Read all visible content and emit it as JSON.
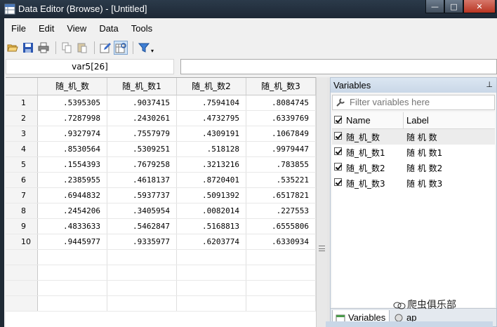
{
  "window": {
    "title": "Data Editor (Browse) - [Untitled]",
    "minimize_glyph": "—",
    "maximize_glyph": "□",
    "close_glyph": "✕"
  },
  "menu": [
    "File",
    "Edit",
    "View",
    "Data",
    "Tools"
  ],
  "toolbar": {
    "icons": [
      "open-icon",
      "save-icon",
      "print-icon",
      "copy-icon",
      "paste-icon",
      "edit-icon",
      "browse-icon",
      "filter-icon"
    ]
  },
  "cell_reference": "var5[26]",
  "grid": {
    "columns": [
      "随_机_数",
      "随_机_数1",
      "随_机_数2",
      "随_机_数3"
    ],
    "rows": [
      {
        "n": "1",
        "v": [
          ".5395305",
          ".9037415",
          ".7594104",
          ".8084745"
        ]
      },
      {
        "n": "2",
        "v": [
          ".7287998",
          ".2430261",
          ".4732795",
          ".6339769"
        ]
      },
      {
        "n": "3",
        "v": [
          ".9327974",
          ".7557979",
          ".4309191",
          ".1067849"
        ]
      },
      {
        "n": "4",
        "v": [
          ".8530564",
          ".5309251",
          ".518128",
          ".9979447"
        ]
      },
      {
        "n": "5",
        "v": [
          ".1554393",
          ".7679258",
          ".3213216",
          ".783855"
        ]
      },
      {
        "n": "6",
        "v": [
          ".2385955",
          ".4618137",
          ".8720401",
          ".535221"
        ]
      },
      {
        "n": "7",
        "v": [
          ".6944832",
          ".5937737",
          ".5091392",
          ".6517821"
        ]
      },
      {
        "n": "8",
        "v": [
          ".2454206",
          ".3405954",
          ".0082014",
          ".227553"
        ]
      },
      {
        "n": "9",
        "v": [
          ".4833633",
          ".5462847",
          ".5168813",
          ".6555806"
        ]
      },
      {
        "n": "10",
        "v": [
          ".9445977",
          ".9335977",
          ".6203774",
          ".6330934"
        ]
      }
    ]
  },
  "variables_panel": {
    "title": "Variables",
    "pin_glyph": "⊥",
    "filter_placeholder": "Filter variables here",
    "name_header": "Name",
    "label_header": "Label",
    "items": [
      {
        "name": "随_机_数",
        "label": "随 机 数"
      },
      {
        "name": "随_机_数1",
        "label": "随 机 数1"
      },
      {
        "name": "随_机_数2",
        "label": "随 机 数2"
      },
      {
        "name": "随_机_数3",
        "label": "随 机 数3"
      }
    ],
    "tab_variables": "Variables",
    "tab_snapshots": "ap"
  },
  "watermark": "爬虫俱乐部"
}
